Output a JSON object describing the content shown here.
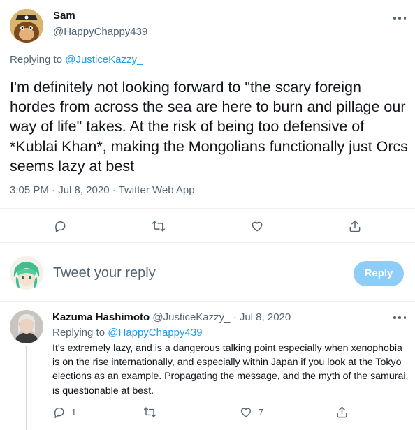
{
  "tweet": {
    "author_name": "Sam",
    "author_handle": "@HappyChappy439",
    "replying_prefix": "Replying to ",
    "replying_handle": "@JusticeKazzy_",
    "text": "I'm definitely not looking forward to \"the scary foreign hordes from across the sea are here to burn and pillage our way of life\" takes. At the risk of being too defensive of *Kublai Khan*, making the Mongolians functionally just Orcs seems lazy at best",
    "timestamp": "3:05 PM · Jul 8, 2020 · Twitter Web App"
  },
  "composer": {
    "placeholder": "Tweet your reply",
    "reply_button": "Reply"
  },
  "reply": {
    "author_name": "Kazuma Hashimoto",
    "author_handle": "@JusticeKazzy_",
    "separator": "·",
    "date": "Jul 8, 2020",
    "replying_prefix": "Replying to ",
    "replying_handle": "@HappyChappy439",
    "text": "It's extremely lazy, and is a dangerous talking point especially when xenophobia is on the rise internationally, and especially within Japan if you look at the Tokyo elections as an example. Propagating the message, and the myth of the samurai, is questionable at best.",
    "reply_count": "1",
    "like_count": "7"
  },
  "icons": [
    "more-icon",
    "reply-icon",
    "retweet-icon",
    "like-icon",
    "share-icon"
  ],
  "colors": {
    "accent": "#1d9bf0",
    "reply_button_disabled": "#8ecdf7",
    "secondary_text": "#536471"
  }
}
